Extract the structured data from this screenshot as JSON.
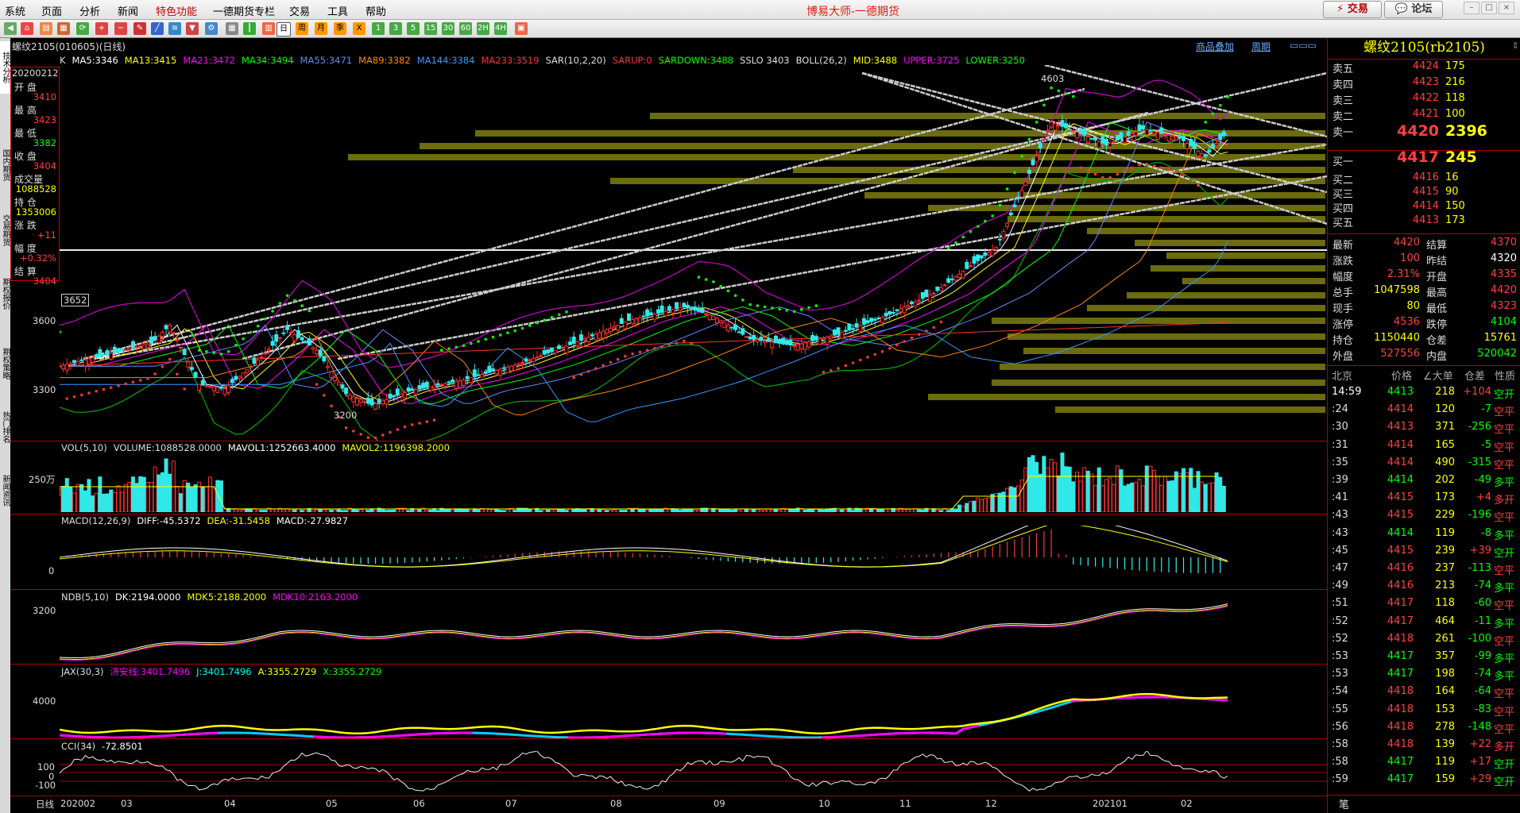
{
  "menu": [
    "系统",
    "页面",
    "分析",
    "新闻",
    "特色功能",
    "一德期货专栏",
    "交易",
    "工具",
    "帮助"
  ],
  "app_title": "博易大师-一德期货",
  "top_buttons": {
    "trade": "交易",
    "forum": "论坛"
  },
  "toolbar_labels": {
    "day": "日",
    "week": "周",
    "month": "月",
    "season": "季",
    "x": "X",
    "m1": "1",
    "m3": "3",
    "m5": "5",
    "m15": "15",
    "m30": "30",
    "m60": "60",
    "h2": "2H",
    "h4": "4H"
  },
  "left_tabs": [
    "技术分析",
    "国内期货",
    "交易期货",
    "期权报价",
    "期权策略",
    "热门排名",
    "新闻资讯"
  ],
  "chart": {
    "title": "螺纹2105(010605)(日线)",
    "header_right": {
      "overlay": "商品叠加",
      "period": "周期"
    },
    "main_indicators": [
      {
        "text": "K",
        "color": "#dddddd"
      },
      {
        "text": "MA5:3346",
        "color": "#ffffff"
      },
      {
        "text": "MA13:3415",
        "color": "#ffff00"
      },
      {
        "text": "MA21:3472",
        "color": "#ff00ff"
      },
      {
        "text": "MA34:3494",
        "color": "#00ff00"
      },
      {
        "text": "MA55:3471",
        "color": "#6688ff"
      },
      {
        "text": "MA89:3382",
        "color": "#ff8800"
      },
      {
        "text": "MA144:3384",
        "color": "#3399ff"
      },
      {
        "text": "MA233:3519",
        "color": "#ff3333"
      },
      {
        "text": "SAR(10,2,20)",
        "color": "#dddddd"
      },
      {
        "text": "SARUP:0",
        "color": "#ff3333"
      },
      {
        "text": "SARDOWN:3488",
        "color": "#00ff00"
      },
      {
        "text": "SSLO 3403",
        "color": "#dddddd"
      },
      {
        "text": "BOLL(26,2)",
        "color": "#dddddd"
      },
      {
        "text": "MID:3488",
        "color": "#ffff00"
      },
      {
        "text": "UPPER:3725",
        "color": "#ff00ff"
      },
      {
        "text": "LOWER:3250",
        "color": "#00ff00"
      }
    ],
    "price_labels": {
      "high_mark": "4603",
      "low_mark": "3200",
      "level_box": "3652",
      "y3600": "3600",
      "y3300": "3300"
    },
    "info_box": {
      "date": "20200212",
      "items": [
        {
          "label": "开 盘",
          "value": "3410",
          "color": "#ff4040"
        },
        {
          "label": "最 高",
          "value": "3423",
          "color": "#ff4040"
        },
        {
          "label": "最 低",
          "value": "3382",
          "color": "#00ff00"
        },
        {
          "label": "收 盘",
          "value": "3404",
          "color": "#ff4040"
        },
        {
          "label": "成交量",
          "value": "1088528",
          "color": "#ffff00"
        },
        {
          "label": "持 仓",
          "value": "1353006",
          "color": "#ffff00"
        },
        {
          "label": "涨 跌",
          "value": "+11",
          "color": "#ff4040"
        },
        {
          "label": "幅 度",
          "value": "+0.32%",
          "color": "#ff4040"
        },
        {
          "label": "结 算",
          "value": "3404",
          "color": "#ff4040"
        }
      ]
    },
    "vol": {
      "title": "VOL(5,10)",
      "volume": "VOLUME:1088528.0000",
      "mavol1": "MAVOL1:1252663.4000",
      "mavol2": "MAVOL2:1196398.2000",
      "axis": "250万"
    },
    "macd": {
      "title": "MACD(12,26,9)",
      "diff": "DIFF:-45.5372",
      "dea": "DEA:-31.5458",
      "macd": "MACD:-27.9827",
      "axis": "0"
    },
    "ndb": {
      "title": "NDB(5,10)",
      "dk": "DK:2194.0000",
      "mdk5": "MDK5:2188.2000",
      "mdk10": "MDK10:2163.2000",
      "axis": "3200"
    },
    "jax": {
      "title": "JAX(30,3)",
      "jl": "济安线:3401.7496",
      "j": "J:3401.7496",
      "a": "A:3355.2729",
      "x": "X:3355.2729",
      "axis": "4000"
    },
    "cci": {
      "title": "CCI(34)",
      "value": "-72.8501",
      "axis": [
        "100",
        "0",
        "-100"
      ]
    },
    "xaxis": {
      "label": "日线",
      "ticks": [
        "202002",
        "03",
        "04",
        "05",
        "06",
        "07",
        "08",
        "09",
        "10",
        "11",
        "12",
        "202101",
        "02"
      ]
    }
  },
  "quote": {
    "title": "螺纹2105(rb2105)",
    "asks": [
      {
        "label": "卖五",
        "price": "4424",
        "vol": "175"
      },
      {
        "label": "卖四",
        "price": "4423",
        "vol": "216"
      },
      {
        "label": "卖三",
        "price": "4422",
        "vol": "118"
      },
      {
        "label": "卖二",
        "price": "4421",
        "vol": "100"
      },
      {
        "label": "卖一",
        "price": "4420",
        "vol": "2396"
      }
    ],
    "bids": [
      {
        "label": "买一",
        "price": "4417",
        "vol": "245"
      },
      {
        "label": "买二",
        "price": "4416",
        "vol": "16"
      },
      {
        "label": "买三",
        "price": "4415",
        "vol": "90"
      },
      {
        "label": "买四",
        "price": "4414",
        "vol": "150"
      },
      {
        "label": "买五",
        "price": "4413",
        "vol": "173"
      }
    ],
    "stats": [
      {
        "l1": "最新",
        "v1": "4420",
        "c1": "#ff4040",
        "l2": "结算",
        "v2": "4370",
        "c2": "#ff4040"
      },
      {
        "l1": "涨跌",
        "v1": "100",
        "c1": "#ff4040",
        "l2": "昨结",
        "v2": "4320",
        "c2": "#ffffff"
      },
      {
        "l1": "幅度",
        "v1": "2.31%",
        "c1": "#ff4040",
        "l2": "开盘",
        "v2": "4335",
        "c2": "#ff4040"
      },
      {
        "l1": "总手",
        "v1": "1047598",
        "c1": "#ffff00",
        "l2": "最高",
        "v2": "4420",
        "c2": "#ff4040"
      },
      {
        "l1": "现手",
        "v1": "80",
        "c1": "#ffff00",
        "l2": "最低",
        "v2": "4323",
        "c2": "#ff4040"
      },
      {
        "l1": "涨停",
        "v1": "4536",
        "c1": "#ff4040",
        "l2": "跌停",
        "v2": "4104",
        "c2": "#00ff00"
      },
      {
        "l1": "持仓",
        "v1": "1150440",
        "c1": "#ffff00",
        "l2": "仓差",
        "v2": "15761",
        "c2": "#ffff00"
      },
      {
        "l1": "外盘",
        "v1": "527556",
        "c1": "#ff4040",
        "l2": "内盘",
        "v2": "520042",
        "c2": "#00ff00"
      }
    ],
    "ticks_header": {
      "place": "北京",
      "price": "价格",
      "vol": "∠大单",
      "chg": "仓差",
      "nature": "性质"
    },
    "ticks": [
      {
        "t": "14:59",
        "p": "4413",
        "v": "218",
        "c": "+104",
        "n": "空开",
        "pc": "#00ff00",
        "cc": "#ff4040",
        "nc": "#00ff00"
      },
      {
        "t": ":24",
        "p": "4414",
        "v": "120",
        "c": "-7",
        "n": "空平",
        "pc": "#ff4040",
        "cc": "#00ff00",
        "nc": "#ff4040"
      },
      {
        "t": ":30",
        "p": "4413",
        "v": "371",
        "c": "-256",
        "n": "空平",
        "pc": "#ff4040",
        "cc": "#00ff00",
        "nc": "#ff4040"
      },
      {
        "t": ":31",
        "p": "4414",
        "v": "165",
        "c": "-5",
        "n": "空平",
        "pc": "#ff4040",
        "cc": "#00ff00",
        "nc": "#ff4040"
      },
      {
        "t": ":35",
        "p": "4414",
        "v": "490",
        "c": "-315",
        "n": "空平",
        "pc": "#ff4040",
        "cc": "#00ff00",
        "nc": "#ff4040"
      },
      {
        "t": ":39",
        "p": "4414",
        "v": "202",
        "c": "-49",
        "n": "多平",
        "pc": "#00ff00",
        "cc": "#00ff00",
        "nc": "#00ff00"
      },
      {
        "t": ":41",
        "p": "4415",
        "v": "173",
        "c": "+4",
        "n": "多开",
        "pc": "#ff4040",
        "cc": "#ff4040",
        "nc": "#ff4040"
      },
      {
        "t": ":43",
        "p": "4415",
        "v": "229",
        "c": "-196",
        "n": "空平",
        "pc": "#ff4040",
        "cc": "#00ff00",
        "nc": "#ff4040"
      },
      {
        "t": ":43",
        "p": "4414",
        "v": "119",
        "c": "-8",
        "n": "多平",
        "pc": "#00ff00",
        "cc": "#00ff00",
        "nc": "#00ff00"
      },
      {
        "t": ":45",
        "p": "4415",
        "v": "239",
        "c": "+39",
        "n": "空开",
        "pc": "#ff4040",
        "cc": "#ff4040",
        "nc": "#00ff00"
      },
      {
        "t": ":47",
        "p": "4416",
        "v": "237",
        "c": "-113",
        "n": "空平",
        "pc": "#ff4040",
        "cc": "#00ff00",
        "nc": "#ff4040"
      },
      {
        "t": ":49",
        "p": "4416",
        "v": "213",
        "c": "-74",
        "n": "多平",
        "pc": "#ff4040",
        "cc": "#00ff00",
        "nc": "#00ff00"
      },
      {
        "t": ":51",
        "p": "4417",
        "v": "118",
        "c": "-60",
        "n": "空平",
        "pc": "#ff4040",
        "cc": "#00ff00",
        "nc": "#ff4040"
      },
      {
        "t": ":52",
        "p": "4417",
        "v": "464",
        "c": "-11",
        "n": "多平",
        "pc": "#ff4040",
        "cc": "#00ff00",
        "nc": "#00ff00"
      },
      {
        "t": ":52",
        "p": "4418",
        "v": "261",
        "c": "-100",
        "n": "空平",
        "pc": "#ff4040",
        "cc": "#00ff00",
        "nc": "#ff4040"
      },
      {
        "t": ":53",
        "p": "4417",
        "v": "357",
        "c": "-99",
        "n": "多平",
        "pc": "#00ff00",
        "cc": "#00ff00",
        "nc": "#00ff00"
      },
      {
        "t": ":53",
        "p": "4417",
        "v": "198",
        "c": "-74",
        "n": "多平",
        "pc": "#00ff00",
        "cc": "#00ff00",
        "nc": "#00ff00"
      },
      {
        "t": ":54",
        "p": "4418",
        "v": "164",
        "c": "-64",
        "n": "空平",
        "pc": "#ff4040",
        "cc": "#00ff00",
        "nc": "#ff4040"
      },
      {
        "t": ":55",
        "p": "4418",
        "v": "153",
        "c": "-83",
        "n": "空平",
        "pc": "#ff4040",
        "cc": "#00ff00",
        "nc": "#ff4040"
      },
      {
        "t": ":56",
        "p": "4418",
        "v": "278",
        "c": "-148",
        "n": "空平",
        "pc": "#ff4040",
        "cc": "#00ff00",
        "nc": "#ff4040"
      },
      {
        "t": ":58",
        "p": "4418",
        "v": "139",
        "c": "+22",
        "n": "多开",
        "pc": "#ff4040",
        "cc": "#ff4040",
        "nc": "#ff4040"
      },
      {
        "t": ":58",
        "p": "4417",
        "v": "119",
        "c": "+17",
        "n": "空开",
        "pc": "#00ff00",
        "cc": "#ff4040",
        "nc": "#00ff00"
      },
      {
        "t": ":59",
        "p": "4417",
        "v": "159",
        "c": "+29",
        "n": "空开",
        "pc": "#00ff00",
        "cc": "#ff4040",
        "nc": "#00ff00"
      }
    ],
    "bottom_label": "笔"
  }
}
